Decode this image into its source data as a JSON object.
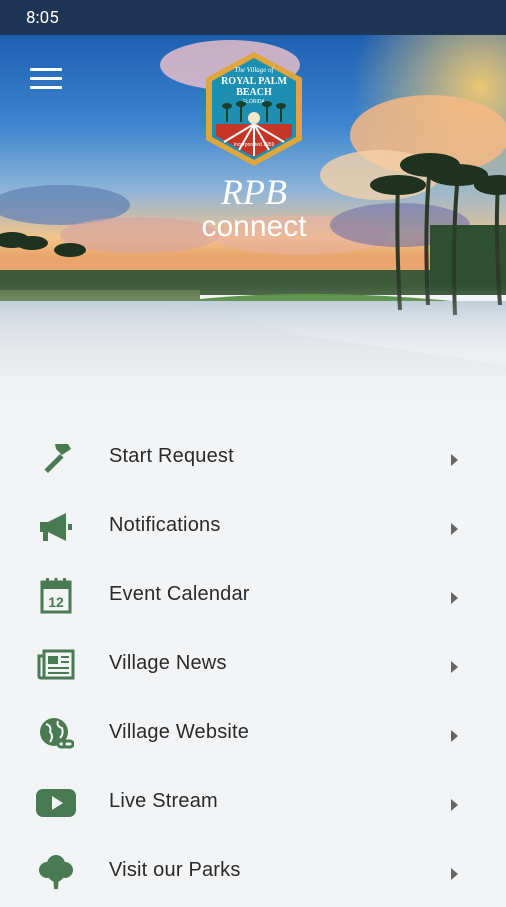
{
  "status_bar": {
    "time": "8:05"
  },
  "colors": {
    "icon_green": "#4a7a52",
    "status_bar": "#1f3554",
    "text": "#2a2a2a",
    "chevron": "#666666"
  },
  "header": {
    "logo": {
      "line1": "The Village of",
      "line2": "ROYAL PALM",
      "line3": "BEACH",
      "line4": "FLORIDA",
      "line5": "Incorporated 1959",
      "wordmark_top": "RPB",
      "wordmark_bottom": "connect"
    }
  },
  "menu": [
    {
      "label": "Start Request",
      "icon": "hammer-icon"
    },
    {
      "label": "Notifications",
      "icon": "megaphone-icon"
    },
    {
      "label": "Event Calendar",
      "icon": "calendar-icon",
      "icon_text": "12"
    },
    {
      "label": "Village News",
      "icon": "newspaper-icon"
    },
    {
      "label": "Village Website",
      "icon": "globe-link-icon"
    },
    {
      "label": "Live Stream",
      "icon": "play-icon"
    },
    {
      "label": "Visit our Parks",
      "icon": "tree-icon"
    }
  ]
}
